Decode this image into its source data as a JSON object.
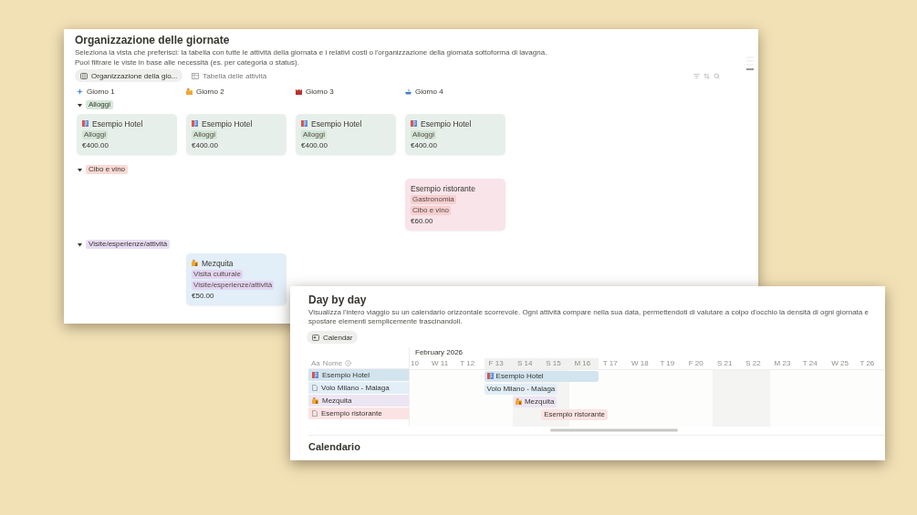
{
  "board": {
    "title": "Organizzazione delle giornate",
    "description": [
      "Seleziona la vista che preferisci: la tabella con  tutte le attività della giornata e i relativi costi o l'organizzazione della giornata sottoforma di lavagna.",
      "Puoi filtrare le viste in base alle necessità (es. per categoria o status)."
    ],
    "views": [
      {
        "kind": "board",
        "label": "Organizzazione della gio...",
        "selected": true
      },
      {
        "kind": "table",
        "label": "Tabella delle attività",
        "selected": false
      }
    ],
    "columns": [
      {
        "kind": "sparkle",
        "label": "Giorno 1"
      },
      {
        "kind": "building",
        "label": "Giorno 2"
      },
      {
        "kind": "castle",
        "label": "Giorno 3"
      },
      {
        "kind": "boat",
        "label": "Giorno 4"
      }
    ],
    "groups": [
      {
        "label": "Alloggi",
        "color": "#d6e8d9",
        "expanded": true,
        "cards": [
          {
            "kind": "hotel",
            "title": "Esempio Hotel",
            "color": "#e7efea",
            "tags": [
              {
                "label": "Alloggi",
                "color": "#d2e6d5"
              }
            ],
            "price": "€400.00"
          },
          {
            "kind": "hotel",
            "title": "Esempio Hotel",
            "color": "#e7efea",
            "tags": [
              {
                "label": "Alloggi",
                "color": "#d2e6d5"
              }
            ],
            "price": "€400.00"
          },
          {
            "kind": "hotel",
            "title": "Esempio Hotel",
            "color": "#e7efea",
            "tags": [
              {
                "label": "Alloggi",
                "color": "#d2e6d5"
              }
            ],
            "price": "€400.00"
          },
          {
            "kind": "hotel",
            "title": "Esempio Hotel",
            "color": "#e7efea",
            "tags": [
              {
                "label": "Alloggi",
                "color": "#d2e6d5"
              }
            ],
            "price": "€400.00"
          }
        ]
      },
      {
        "label": "Cibo e vino",
        "color": "#fbd9d4",
        "expanded": true,
        "cards": [
          {
            "kind": "empty"
          },
          {
            "kind": "empty"
          },
          {
            "kind": "empty"
          },
          {
            "kind": "plain",
            "title": "Esempio ristorante",
            "color": "#f9e4ea",
            "tags": [
              {
                "label": "Gastronomia",
                "color": "#f6cfcf"
              },
              {
                "label": "Cibo e vino",
                "color": "#f6cfcf"
              }
            ],
            "price": "€60.00"
          }
        ]
      },
      {
        "label": "Visite/esperienze/attività",
        "color": "#e8dcf4",
        "expanded": true,
        "cards": [
          {
            "kind": "empty"
          },
          {
            "kind": "monument",
            "title": "Mezquita",
            "color": "#e2eef8",
            "tags": [
              {
                "label": "Visita culturale",
                "color": "#e2d6f2"
              },
              {
                "label": "Visite/esperienze/attività",
                "color": "#e2d6f2"
              }
            ],
            "price": "€50.00"
          },
          {
            "kind": "empty"
          },
          {
            "kind": "empty"
          }
        ]
      }
    ]
  },
  "timeline": {
    "title": "Day by day",
    "description": "Visualizza l'intero viaggio su un calendario orizzontale scorrevole. Ogni attività compare nella sua data, permettendoti di valutare a colpo d'occhio la densità di ogni giornata e spostare elementi semplicemente trascinandoli.",
    "view_tab": {
      "label": "Calendar",
      "selected": true
    },
    "month": "February 2026",
    "name_header": {
      "type_icon": "Aa",
      "label": "Nome"
    },
    "days": [
      {
        "label": "10",
        "weekend": false,
        "highlighted": false
      },
      {
        "label": "W 11",
        "weekend": false,
        "highlighted": false
      },
      {
        "label": "T 12",
        "weekend": false,
        "highlighted": false
      },
      {
        "label": "F 13",
        "weekend": false,
        "highlighted": true
      },
      {
        "label": "S 14",
        "weekend": true,
        "highlighted": true
      },
      {
        "label": "S 15",
        "weekend": true,
        "highlighted": true
      },
      {
        "label": "M 16",
        "weekend": false,
        "highlighted": true
      },
      {
        "label": "T 17",
        "weekend": false,
        "highlighted": false
      },
      {
        "label": "W 18",
        "weekend": false,
        "highlighted": false
      },
      {
        "label": "T 19",
        "weekend": false,
        "highlighted": false
      },
      {
        "label": "F 20",
        "weekend": false,
        "highlighted": false
      },
      {
        "label": "S 21",
        "weekend": true,
        "highlighted": false
      },
      {
        "label": "S 22",
        "weekend": true,
        "highlighted": false
      },
      {
        "label": "M 23",
        "weekend": false,
        "highlighted": false
      },
      {
        "label": "T 24",
        "weekend": false,
        "highlighted": false
      },
      {
        "label": "W 25",
        "weekend": false,
        "highlighted": false
      },
      {
        "label": "T 26",
        "weekend": false,
        "highlighted": false
      }
    ],
    "rows": [
      {
        "kind": "hotel",
        "title": "Esempio Hotel",
        "color": "#d2e4ee",
        "bar_label": "Esempio Hotel"
      },
      {
        "kind": "page",
        "title": "Volo Milano - Malaga",
        "color": "#e2eef8",
        "bar_label": "Volo Milano - Malaga"
      },
      {
        "kind": "monument",
        "title": "Mezquita",
        "color": "#ece5f4",
        "bar_label": "Mezquita"
      },
      {
        "kind": "page",
        "title": "Esempio ristorante",
        "color": "#fbe3e3",
        "bar_label": "Esempio ristorante"
      }
    ],
    "next_section": "Calendario"
  }
}
